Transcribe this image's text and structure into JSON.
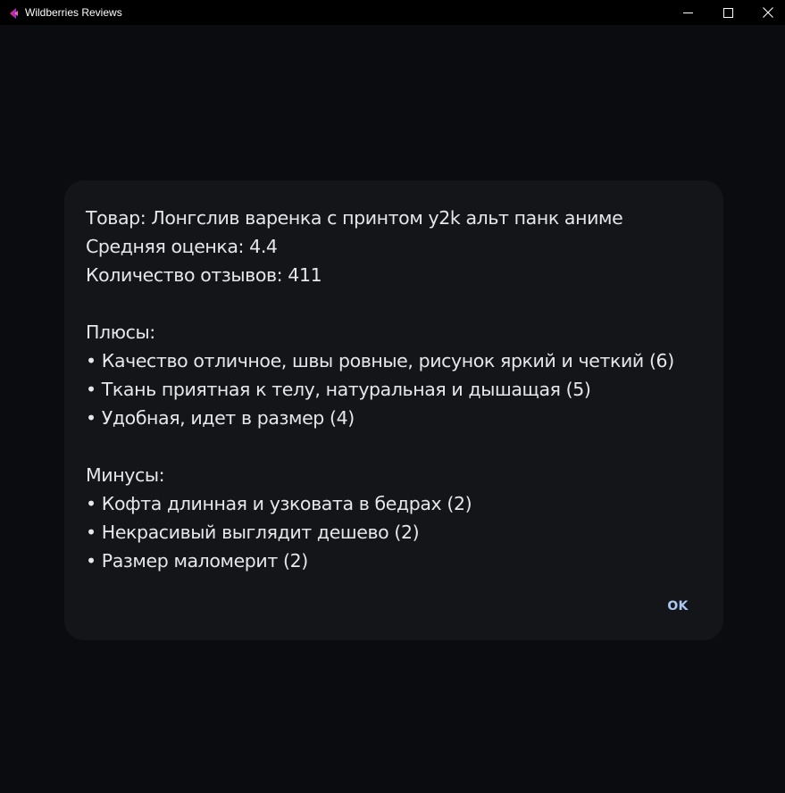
{
  "window": {
    "title": "Wildberries Reviews",
    "icon": "wildberries-logo-icon",
    "controls": {
      "minimize_icon": "minimize-icon",
      "maximize_icon": "maximize-icon",
      "close_icon": "close-icon"
    }
  },
  "dialog": {
    "product_line": "Товар: Лонгслив варенка с принтом y2k альт панк аниме",
    "rating_line": "Средняя оценка: 4.4",
    "count_line": "Количество отзывов: 411",
    "pros_heading": "Плюсы:",
    "pros": [
      "• Качество отличное, швы ровные, рисунок яркий и четкий (6)",
      "• Ткань приятная к телу, натуральная и дышащая (5)",
      "• Удобная, идет в размер (4)"
    ],
    "cons_heading": "Минусы:",
    "cons": [
      "• Кофта длинная и узковата в бедрах (2)",
      "• Некрасивый выглядит дешево (2)",
      "• Размер маломерит (2)"
    ],
    "ok_label": "OK"
  },
  "colors": {
    "background": "#0b0c0f",
    "titlebar": "#000000",
    "dialog": "#131519",
    "text": "#e6e7ea",
    "accent": "#a9c7f2",
    "logo_pink": "#e0306e",
    "logo_purple": "#8a2be2"
  }
}
